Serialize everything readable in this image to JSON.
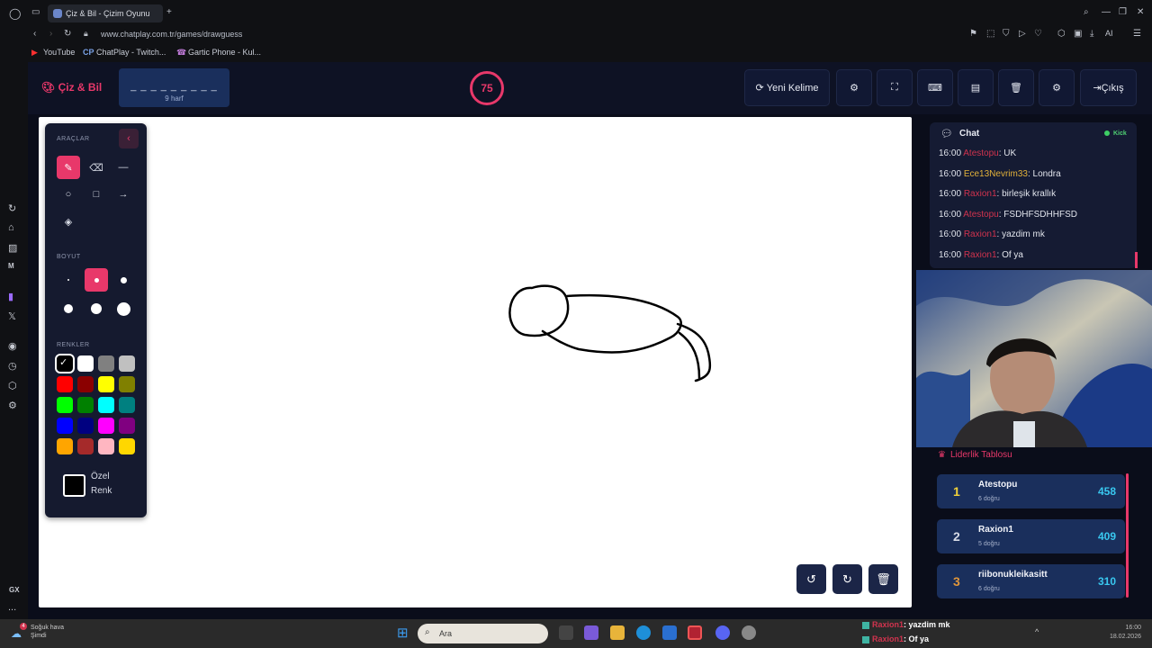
{
  "browser": {
    "tab_title": "Çiz & Bil - Çizim Oyunu",
    "new_tab": "+",
    "url": "www.chatplay.com.tr/games/drawguess",
    "ai_label": "AI",
    "bookmarks": [
      "YouTube",
      "ChatPlay - Twitch...",
      "Gartic Phone - Kul..."
    ],
    "sidebar_gx": "GX",
    "sidebar_more": "..."
  },
  "header": {
    "logo": "Çiz & Bil",
    "word_dashes": "_ _ _ _ _ _ _ _ _",
    "word_hint": "9 harf",
    "timer": "75",
    "new_word_label": "Yeni Kelime",
    "exit_label": "Çıkış"
  },
  "tools": {
    "title": "ARAÇLAR",
    "size_title": "BOYUT",
    "colors_title": "RENKLER",
    "custom_color_line1": "Özel",
    "custom_color_line2": "Renk",
    "colors": [
      "#000000",
      "#ffffff",
      "#808080",
      "#c0c0c0",
      "#ff0000",
      "#8b0000",
      "#ffff00",
      "#808000",
      "#00ff00",
      "#008000",
      "#00ffff",
      "#008080",
      "#0000ff",
      "#000080",
      "#ff00ff",
      "#800080",
      "#ffa500",
      "#a52a2a",
      "#ffb6c1",
      "#ffd700"
    ]
  },
  "chat": {
    "title": "Chat",
    "platform": "Kick",
    "messages": [
      {
        "time": "16:00",
        "user": "Atestopu",
        "text": ": UK"
      },
      {
        "time": "16:00",
        "user": "Ece13Nevrim33",
        "text": ": Londra"
      },
      {
        "time": "16:00",
        "user": "Raxion1",
        "text": ": birleşik krallık"
      },
      {
        "time": "16:00",
        "user": "Atestopu",
        "text": ": FSDHFSDHHFSD"
      },
      {
        "time": "16:00",
        "user": "Raxion1",
        "text": ": yazdim mk"
      },
      {
        "time": "16:00",
        "user": "Raxion1",
        "text": ": Of ya"
      }
    ]
  },
  "leaderboard": {
    "title": "Liderlik Tablosu",
    "rows": [
      {
        "rank": "1",
        "name": "Atestopu",
        "sub": "6 doğru",
        "score": "458"
      },
      {
        "rank": "2",
        "name": "Raxion1",
        "sub": "5 doğru",
        "score": "409"
      },
      {
        "rank": "3",
        "name": "riibonukleikasitt",
        "sub": "6 doğru",
        "score": "310"
      }
    ]
  },
  "taskbar": {
    "search_placeholder": "Ara",
    "weather_line1": "Soğuk hava",
    "weather_line2": "Şimdi",
    "notif_badge": "4",
    "time": "16:00",
    "date": "18.02.2026",
    "notifications": [
      {
        "user": "Raxion1",
        "text": ": yazdim mk"
      },
      {
        "user": "Raxion1",
        "text": ": Of ya"
      }
    ]
  }
}
